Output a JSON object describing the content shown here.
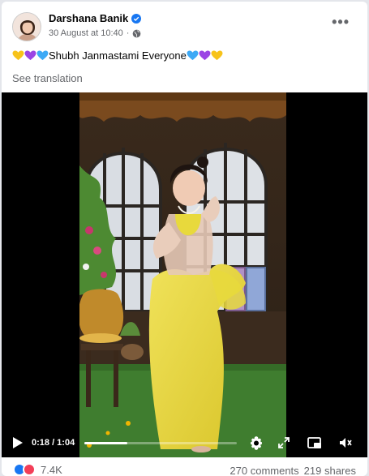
{
  "post": {
    "author_name": "Darshana Banik",
    "date": "30 August at 10:40",
    "dot": "·",
    "caption": "Shubh Janmastami Everyone",
    "see_translation": "See translation"
  },
  "video": {
    "current_time": "0:18",
    "duration": "1:04",
    "time_display": "0:18 / 1:04",
    "progress_fraction": 0.28
  },
  "footer": {
    "reaction_count": "7.4K",
    "comments": "270 comments",
    "shares": "219 shares"
  },
  "icons": {
    "verified": "verified-badge-icon",
    "privacy": "globe-icon",
    "more": "more-options-icon",
    "play": "play-icon",
    "settings": "gear-icon",
    "fullscreen": "fullscreen-icon",
    "pip": "picture-in-picture-icon",
    "volume": "volume-icon"
  },
  "colors": {
    "verified_blue": "#1877f2",
    "heart_yellow": "#f7c31b",
    "heart_purple": "#9b45e4",
    "heart_blue": "#3da9f5",
    "saree_yellow": "#e8d93c",
    "grass_green": "#3f7d2f"
  }
}
